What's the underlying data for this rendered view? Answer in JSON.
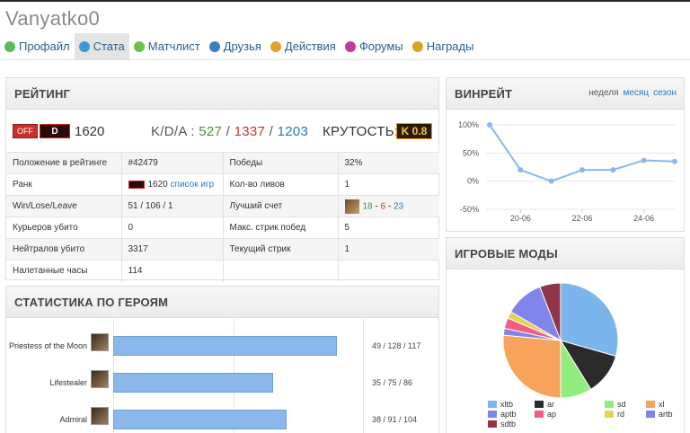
{
  "user": {
    "name": "Vanyatko0"
  },
  "nav": [
    {
      "label": "Профайл",
      "icon": "profile-icon",
      "color": "#5cb85c"
    },
    {
      "label": "Стата",
      "icon": "stats-icon",
      "color": "#3a9ad9",
      "active": true
    },
    {
      "label": "Матчлист",
      "icon": "matchlist-icon",
      "color": "#6cc04a"
    },
    {
      "label": "Друзья",
      "icon": "friends-icon",
      "color": "#3a7fc1"
    },
    {
      "label": "Действия",
      "icon": "actions-icon",
      "color": "#e0a030"
    },
    {
      "label": "Форумы",
      "icon": "forums-icon",
      "color": "#c0399a"
    },
    {
      "label": "Награды",
      "icon": "awards-icon",
      "color": "#d9a520"
    }
  ],
  "rating": {
    "title": "РЕЙТИНГ",
    "off_label": "OFF",
    "d_label": "D",
    "value": "1620",
    "kda_label": "K/D/A :",
    "kills": "527",
    "deaths": "1337",
    "assists": "1203",
    "cool_label": "КРУТОСТЬ:",
    "cool_value": "K 0.8",
    "rows": [
      {
        "l1": "Положение в рейтинге",
        "v1": "#42479",
        "l2": "Победы",
        "v2": "32%"
      },
      {
        "l1": "Ранк",
        "v1": "1620",
        "v1_link": "список игр",
        "l2": "Кол-во ливов",
        "v2": "1"
      },
      {
        "l1": "Win/Lose/Leave",
        "v1": "51 / 106 / 1",
        "l2": "Лучший счет",
        "best_k": "18",
        "best_d": "6",
        "best_a": "23"
      },
      {
        "l1": "Курьеров убито",
        "v1": "0",
        "l2": "Макс. стрик побед",
        "v2": "5"
      },
      {
        "l1": "Нейтралов убито",
        "v1": "3317",
        "l2": "Текущий стрик",
        "v2": "1"
      },
      {
        "l1": "Налетанные часы",
        "v1": "114",
        "l2": "",
        "v2": ""
      }
    ]
  },
  "heroes": {
    "title": "СТАТИСТИКА ПО ГЕРОЯМ",
    "items": [
      {
        "name": "Priestess of the Moon",
        "games": 49,
        "kda": "49 / 128 / 117"
      },
      {
        "name": "Lifestealer",
        "games": 35,
        "kda": "35 / 75 / 86"
      },
      {
        "name": "Admiral",
        "games": 38,
        "kda": "38 / 91 / 104"
      }
    ],
    "max": 60
  },
  "winrate": {
    "title": "ВИНРЕЙТ",
    "tab_week": "неделя",
    "tab_month": "месяц",
    "tab_season": "сезон"
  },
  "modes": {
    "title": "ИГРОВЫЕ МОДЫ"
  },
  "chart_data": [
    {
      "type": "line",
      "x": [
        "19-06",
        "20-06",
        "21-06",
        "22-06",
        "23-06",
        "24-06",
        "25-06"
      ],
      "x_tick_labels": [
        "20-06",
        "22-06",
        "24-06"
      ],
      "y_tick_labels": [
        "100%",
        "50%",
        "0%",
        "-50%"
      ],
      "series": [
        {
          "values": [
            100,
            20,
            0,
            20,
            20,
            37,
            35
          ]
        }
      ],
      "ylim": [
        -50,
        100
      ],
      "grid": true,
      "color": "#8ab8ea"
    },
    {
      "type": "pie",
      "labels": [
        "xltb",
        "ar",
        "sd",
        "xl",
        "aptb",
        "ap",
        "rd",
        "artb",
        "sdtb"
      ],
      "values": [
        30,
        12,
        9,
        27,
        2,
        3,
        2,
        11,
        6
      ],
      "colors": [
        "#7cb5ec",
        "#2b2b2b",
        "#90ed7d",
        "#f7a35c",
        "#8085e9",
        "#f15c80",
        "#e4d354",
        "#8085e9",
        "#91344a"
      ],
      "legend_position": "bottom"
    }
  ]
}
